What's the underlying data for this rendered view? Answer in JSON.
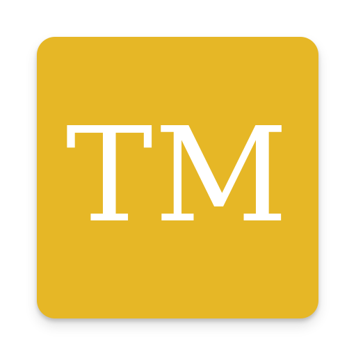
{
  "icon": {
    "monogram": "TM",
    "background_color": "#E6B726",
    "text_color": "#FFFFFF"
  }
}
